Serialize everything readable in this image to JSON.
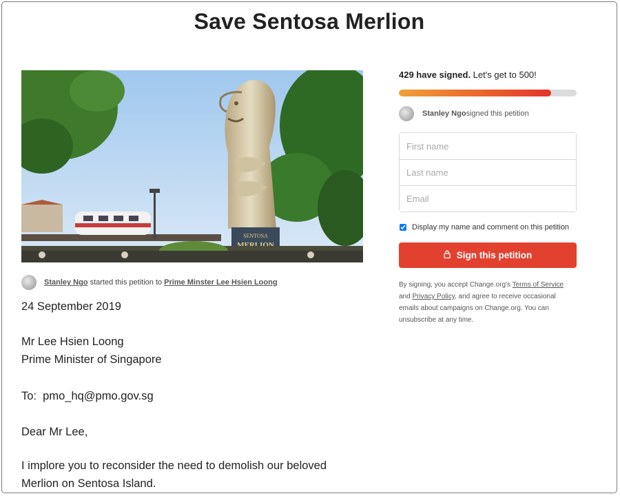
{
  "page": {
    "title": "Save Sentosa Merlion"
  },
  "hero": {
    "sign_line1": "SENTOSA",
    "sign_line2": "MERLION",
    "icon": "merlion-photo"
  },
  "starter": {
    "name": "Stanley Ngo",
    "middle": "started this petition to",
    "target": "Prime Minster Lee Hsien Loong"
  },
  "letter": {
    "date": "24 September 2019",
    "recipient_name": "Mr Lee Hsien Loong",
    "recipient_title": "Prime Minister of Singapore",
    "to_line": "To:  pmo_hq@pmo.gov.sg",
    "salutation": "Dear Mr Lee,",
    "body_line1": "I implore you to reconsider the need to demolish our beloved",
    "body_line2": "Merlion on Sentosa Island."
  },
  "sidebar": {
    "signed_count": "429 have signed.",
    "goal_text": " Let's get to 500!",
    "progress_fraction": 0.858,
    "recent_signer_name": "Stanley Ngo",
    "recent_signer_text": " signed this petition",
    "first_name_placeholder": "First name",
    "last_name_placeholder": "Last name",
    "email_placeholder": "Email",
    "display_checkbox_label": "Display my name and comment on this petition",
    "display_checkbox_checked": true,
    "sign_button_label": "Sign this petition",
    "legal_1": "By signing, you accept Change.org's ",
    "terms_link": "Terms of Service",
    "legal_2": " and ",
    "privacy_link": "Privacy Policy",
    "legal_3": ", and agree to receive occasional emails about campaigns on Change.org. You can unsubscribe at any time."
  },
  "colors": {
    "accent_red": "#e2412f",
    "progress_start": "#f0a03a",
    "progress_end": "#e3342a"
  }
}
